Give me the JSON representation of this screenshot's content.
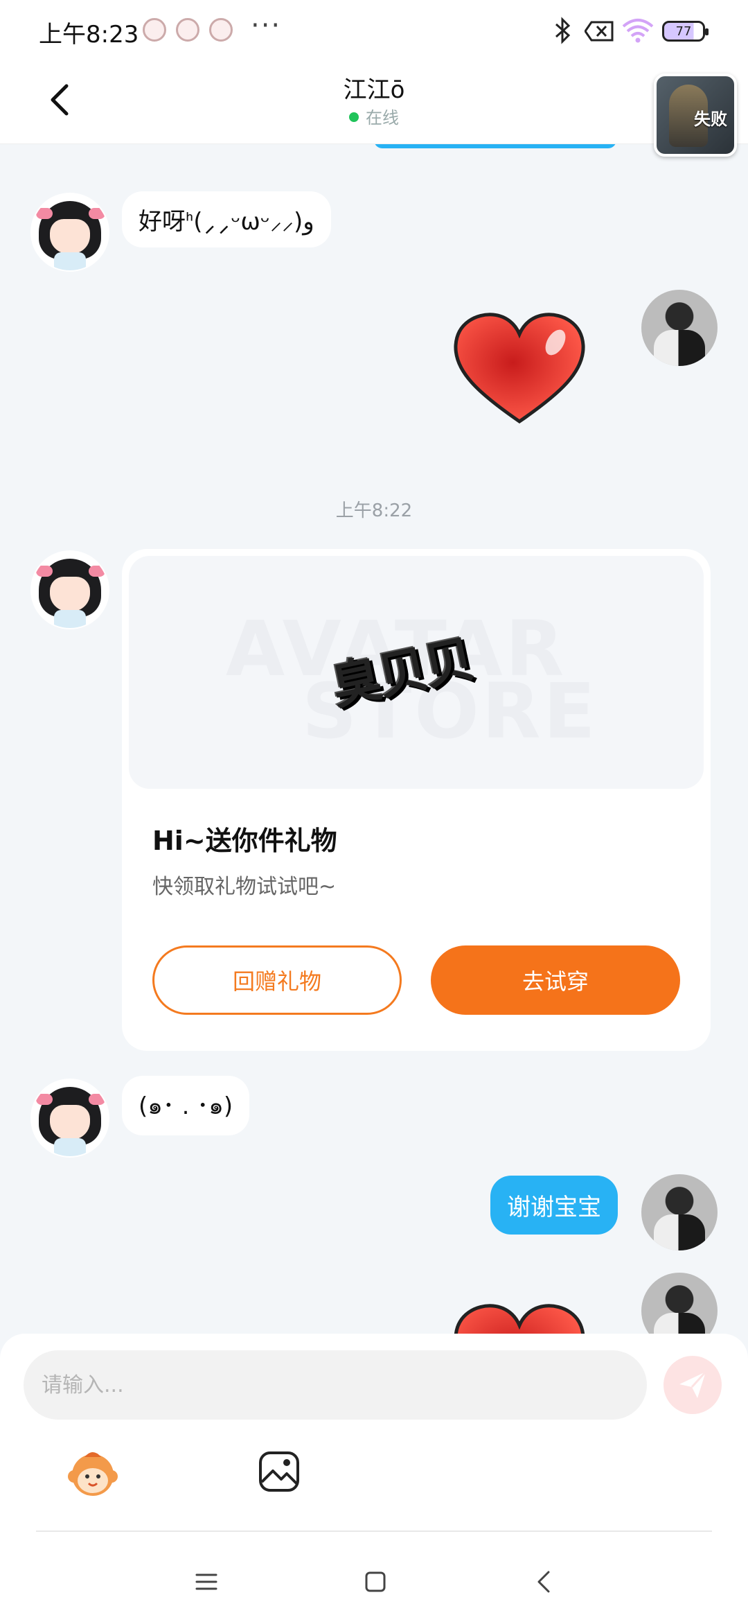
{
  "status_bar": {
    "time": "上午8:23",
    "dots": "···",
    "battery": "77"
  },
  "header": {
    "contact_name": "江江ō",
    "status": "在线",
    "game_badge_label": "失败"
  },
  "messages": {
    "m1_text": "好呀ᑋ(⸝⸝ᵕωᵕ⸝⸝)و",
    "timestamp": "上午8:22",
    "gift": {
      "title": "Hi~送你件礼物",
      "subtitle": "快领取礼物试试吧~",
      "item_text": "臭贝贝",
      "watermark_line1": "AVATAR",
      "watermark_line2": "STORE",
      "return_gift_label": "回赠礼物",
      "try_on_label": "去试穿"
    },
    "m2_text": "(๑･ . ･๑)",
    "m3_text": "谢谢宝宝"
  },
  "input": {
    "placeholder": "请输入..."
  },
  "colors": {
    "accent_blue": "#28b2f4",
    "accent_orange": "#f5731a",
    "online_green": "#20c35a"
  }
}
